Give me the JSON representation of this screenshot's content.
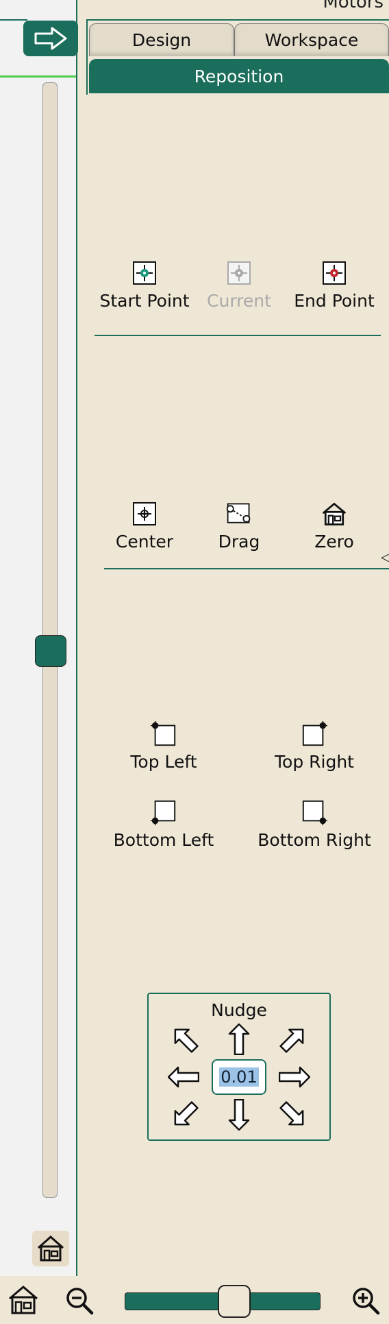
{
  "header": {
    "corner_label": "Motors"
  },
  "tabs": [
    {
      "label": "Design",
      "active": false
    },
    {
      "label": "Workspace",
      "active": false
    }
  ],
  "active_tab": {
    "label": "Reposition"
  },
  "point_tools": [
    {
      "label": "Start Point",
      "icon": "start-point-icon",
      "color": "#1a9a7a",
      "enabled": true
    },
    {
      "label": "Current",
      "icon": "current-point-icon",
      "color": "#a8a8a8",
      "enabled": false
    },
    {
      "label": "End Point",
      "icon": "end-point-icon",
      "color": "#c0282d",
      "enabled": true
    }
  ],
  "position_tools": [
    {
      "label": "Center",
      "icon": "center-icon"
    },
    {
      "label": "Drag",
      "icon": "drag-icon"
    },
    {
      "label": "Zero",
      "icon": "home-icon"
    }
  ],
  "corner_tools": [
    {
      "label": "Top Left",
      "icon": "top-left-corner-icon"
    },
    {
      "label": "Top Right",
      "icon": "top-right-corner-icon"
    },
    {
      "label": "Bottom Left",
      "icon": "bottom-left-corner-icon"
    },
    {
      "label": "Bottom Right",
      "icon": "bottom-right-corner-icon"
    }
  ],
  "nudge": {
    "title": "Nudge",
    "value": "0.01",
    "arrows": [
      "up-left",
      "up",
      "up-right",
      "left",
      "right",
      "down-left",
      "down",
      "down-right"
    ]
  },
  "colors": {
    "accent": "#1b6e5b",
    "background": "#efe7d6",
    "highlight": "#4ccc4c",
    "selection": "#9cc3e6"
  }
}
